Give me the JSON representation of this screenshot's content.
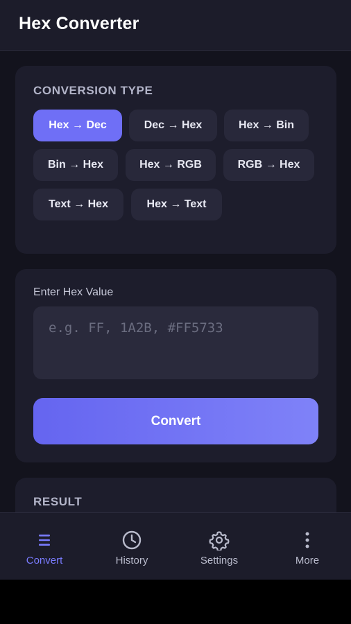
{
  "header": {
    "title": "Hex Converter"
  },
  "conversion": {
    "section_title": "CONVERSION TYPE",
    "options": [
      {
        "label": "Hex → Dec",
        "active": true
      },
      {
        "label": "Dec → Hex",
        "active": false
      },
      {
        "label": "Hex → Bin",
        "active": false
      },
      {
        "label": "Bin → Hex",
        "active": false
      },
      {
        "label": "Hex → RGB",
        "active": false
      },
      {
        "label": "RGB → Hex",
        "active": false
      },
      {
        "label": "Text → Hex",
        "active": false
      },
      {
        "label": "Hex → Text",
        "active": false
      }
    ]
  },
  "input": {
    "label": "Enter Hex Value",
    "placeholder": "e.g. FF, 1A2B, #FF5733",
    "value": "",
    "convert_label": "Convert"
  },
  "result": {
    "section_title": "RESULT"
  },
  "nav": {
    "items": [
      {
        "label": "Convert",
        "icon": "menu-lines-icon",
        "active": true
      },
      {
        "label": "History",
        "icon": "clock-icon",
        "active": false
      },
      {
        "label": "Settings",
        "icon": "gear-icon",
        "active": false
      },
      {
        "label": "More",
        "icon": "more-vertical-icon",
        "active": false
      }
    ]
  },
  "colors": {
    "accent": "#6f6ff6",
    "active_nav": "#7a7cff",
    "background": "#13131d",
    "card": "#1d1d2c",
    "chip": "#28283a"
  }
}
